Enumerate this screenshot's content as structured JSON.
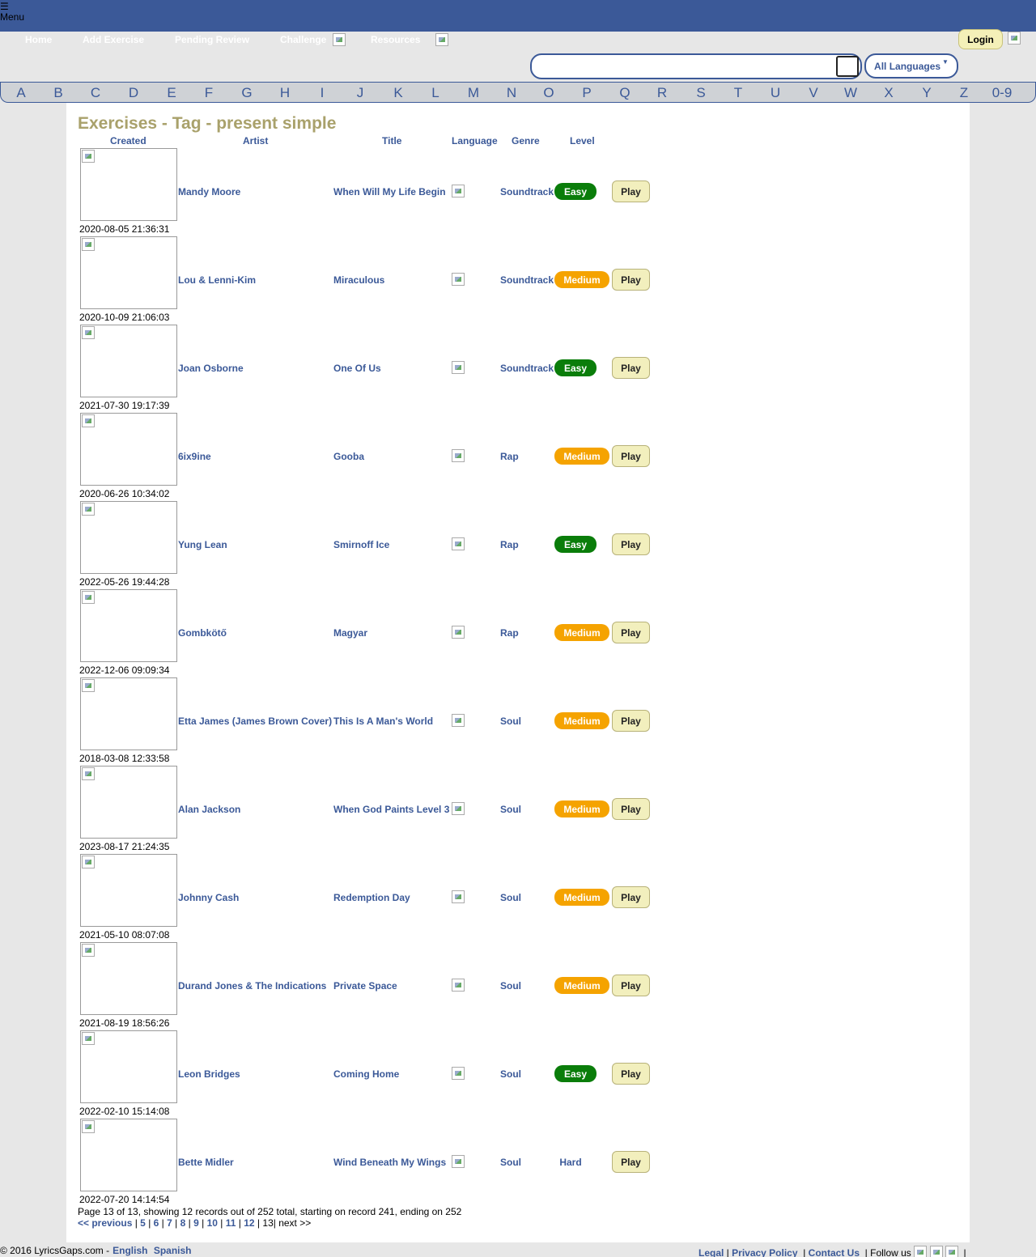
{
  "header": {
    "menu_icon": "☰",
    "menu_label": "Menu"
  },
  "nav": {
    "home": "Home",
    "add_exercise": "Add Exercise",
    "pending_review": "Pending Review",
    "challenge": "Challenge",
    "resources": "Resources",
    "login": "Login"
  },
  "search": {
    "value": "",
    "placeholder": "",
    "language_select": "All Languages"
  },
  "alphabet": [
    "A",
    "B",
    "C",
    "D",
    "E",
    "F",
    "G",
    "H",
    "I",
    "J",
    "K",
    "L",
    "M",
    "N",
    "O",
    "P",
    "Q",
    "R",
    "S",
    "T",
    "U",
    "V",
    "W",
    "X",
    "Y",
    "Z",
    "0-9"
  ],
  "main": {
    "title": "Exercises - Tag - present simple",
    "columns": {
      "created": "Created",
      "artist": "Artist",
      "title": "Title",
      "language": "Language",
      "genre": "Genre",
      "level": "Level"
    },
    "play_label": "Play",
    "rows": [
      {
        "created": "2020-08-05 21:36:31",
        "artist": "Mandy Moore",
        "title": "When Will My Life Begin",
        "genre": "Soundtrack",
        "level": "Easy",
        "level_class": "easy"
      },
      {
        "created": "2020-10-09 21:06:03",
        "artist": "Lou & Lenni-Kim",
        "title": "Miraculous",
        "genre": "Soundtrack",
        "level": "Medium",
        "level_class": "medium"
      },
      {
        "created": "2021-07-30 19:17:39",
        "artist": "Joan Osborne",
        "title": "One Of Us",
        "genre": "Soundtrack",
        "level": "Easy",
        "level_class": "easy"
      },
      {
        "created": "2020-06-26 10:34:02",
        "artist": "6ix9ine",
        "title": "Gooba",
        "genre": "Rap",
        "level": "Medium",
        "level_class": "medium"
      },
      {
        "created": "2022-05-26 19:44:28",
        "artist": "Yung Lean",
        "title": "Smirnoff Ice",
        "genre": "Rap",
        "level": "Easy",
        "level_class": "easy"
      },
      {
        "created": "2022-12-06 09:09:34",
        "artist": "Gombkötő",
        "title": "Magyar",
        "genre": "Rap",
        "level": "Medium",
        "level_class": "medium"
      },
      {
        "created": "2018-03-08 12:33:58",
        "artist": "Etta James (James Brown Cover)",
        "title": "This Is A Man's World",
        "genre": "Soul",
        "level": "Medium",
        "level_class": "medium"
      },
      {
        "created": "2023-08-17 21:24:35",
        "artist": "Alan Jackson",
        "title": "When God Paints Level 3",
        "genre": "Soul",
        "level": "Medium",
        "level_class": "medium"
      },
      {
        "created": "2021-05-10 08:07:08",
        "artist": "Johnny Cash",
        "title": "Redemption Day",
        "genre": "Soul",
        "level": "Medium",
        "level_class": "medium"
      },
      {
        "created": "2021-08-19 18:56:26",
        "artist": "Durand Jones & The Indications",
        "title": "Private Space",
        "genre": "Soul",
        "level": "Medium",
        "level_class": "medium"
      },
      {
        "created": "2022-02-10 15:14:08",
        "artist": "Leon Bridges",
        "title": "Coming Home",
        "genre": "Soul",
        "level": "Easy",
        "level_class": "easy"
      },
      {
        "created": "2022-07-20 14:14:54",
        "artist": "Bette Midler",
        "title": "Wind Beneath My Wings",
        "genre": "Soul",
        "level": "Hard",
        "level_class": "hard"
      }
    ],
    "paging_info": "Page 13 of 13, showing 12 records out of 252 total, starting on record 241, ending on 252",
    "pager": {
      "previous": "<< previous",
      "pages": [
        "5",
        "6",
        "7",
        "8",
        "9",
        "10",
        "11",
        "12"
      ],
      "current": "13",
      "next": "next >>"
    }
  },
  "footer": {
    "copyright": "© 2016 LyricsGaps.com -",
    "lang_english": "English",
    "lang_spanish": "Spanish",
    "legal": "Legal",
    "privacy": "Privacy Policy",
    "contact": "Contact Us",
    "follow": "Follow us"
  }
}
